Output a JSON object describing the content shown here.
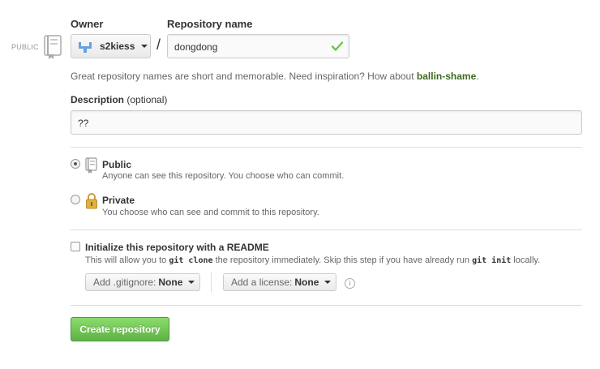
{
  "owner": {
    "label": "Owner",
    "selected": "s2kiess"
  },
  "repo": {
    "label": "Repository name",
    "value": "dongdong",
    "separator": "/"
  },
  "visibility_tag": "PUBLIC",
  "hint": {
    "prefix": "Great repository names are short and memorable. Need inspiration? How about",
    "suggestion": "ballin-shame",
    "suffix": "."
  },
  "description": {
    "label": "Description",
    "optional": "(optional)",
    "value": "??"
  },
  "options": {
    "public": {
      "title": "Public",
      "subtitle": "Anyone can see this repository. You choose who can commit.",
      "selected": true
    },
    "private": {
      "title": "Private",
      "subtitle": "You choose who can see and commit to this repository.",
      "selected": false
    }
  },
  "init": {
    "title": "Initialize this repository with a README",
    "sub_1": "This will allow you to",
    "code_1": "git clone",
    "sub_2": "the repository immediately. Skip this step if you have already run",
    "code_2": "git init",
    "sub_3": "locally.",
    "checked": false
  },
  "gitignore": {
    "label": "Add .gitignore:",
    "value": "None"
  },
  "license": {
    "label": "Add a license:",
    "value": "None"
  },
  "info_glyph": "i",
  "create_button": "Create repository",
  "colors": {
    "accent_green": "#60b044",
    "suggestion_green": "#3d6a1e",
    "check_green": "#6cc644",
    "lock_gold": "#e0b040"
  }
}
